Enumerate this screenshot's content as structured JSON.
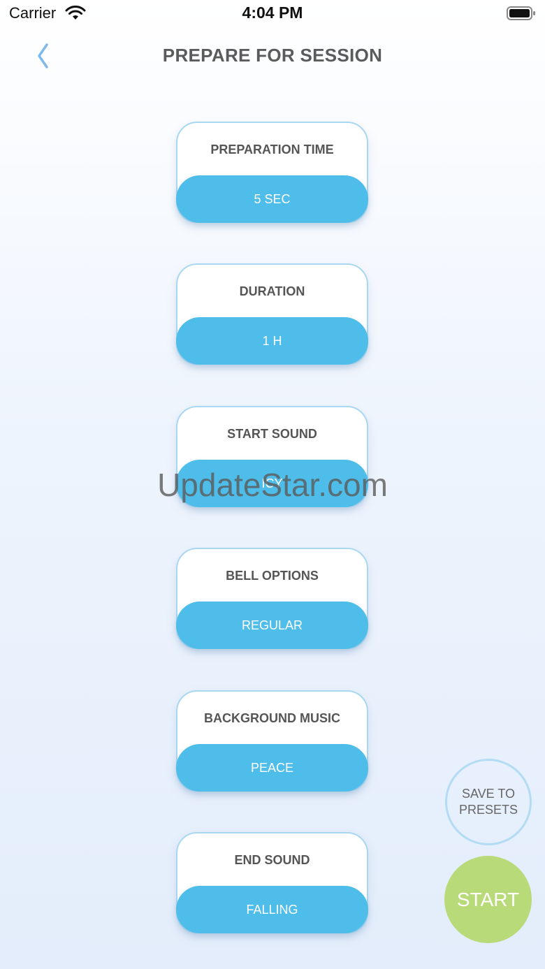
{
  "status_bar": {
    "carrier": "Carrier",
    "time": "4:04 PM",
    "wifi_icon": "wifi-icon",
    "battery_icon": "battery-icon"
  },
  "header": {
    "back_icon": "chevron-left-icon",
    "title": "PREPARE FOR SESSION"
  },
  "settings": [
    {
      "label": "PREPARATION TIME",
      "value": "5 SEC"
    },
    {
      "label": "DURATION",
      "value": "1 H"
    },
    {
      "label": "START SOUND",
      "value": "ICY"
    },
    {
      "label": "BELL OPTIONS",
      "value": "REGULAR"
    },
    {
      "label": "BACKGROUND MUSIC",
      "value": "PEACE"
    },
    {
      "label": "END SOUND",
      "value": "FALLING"
    }
  ],
  "watermark": "UpdateStar.com",
  "actions": {
    "save_presets_line1": "SAVE TO",
    "save_presets_line2": "PRESETS",
    "start_label": "START"
  },
  "colors": {
    "accent_blue": "#4fbde9",
    "card_border": "#a9d7f2",
    "start_green": "#b9da79",
    "back_chevron": "#7fb8ee"
  }
}
